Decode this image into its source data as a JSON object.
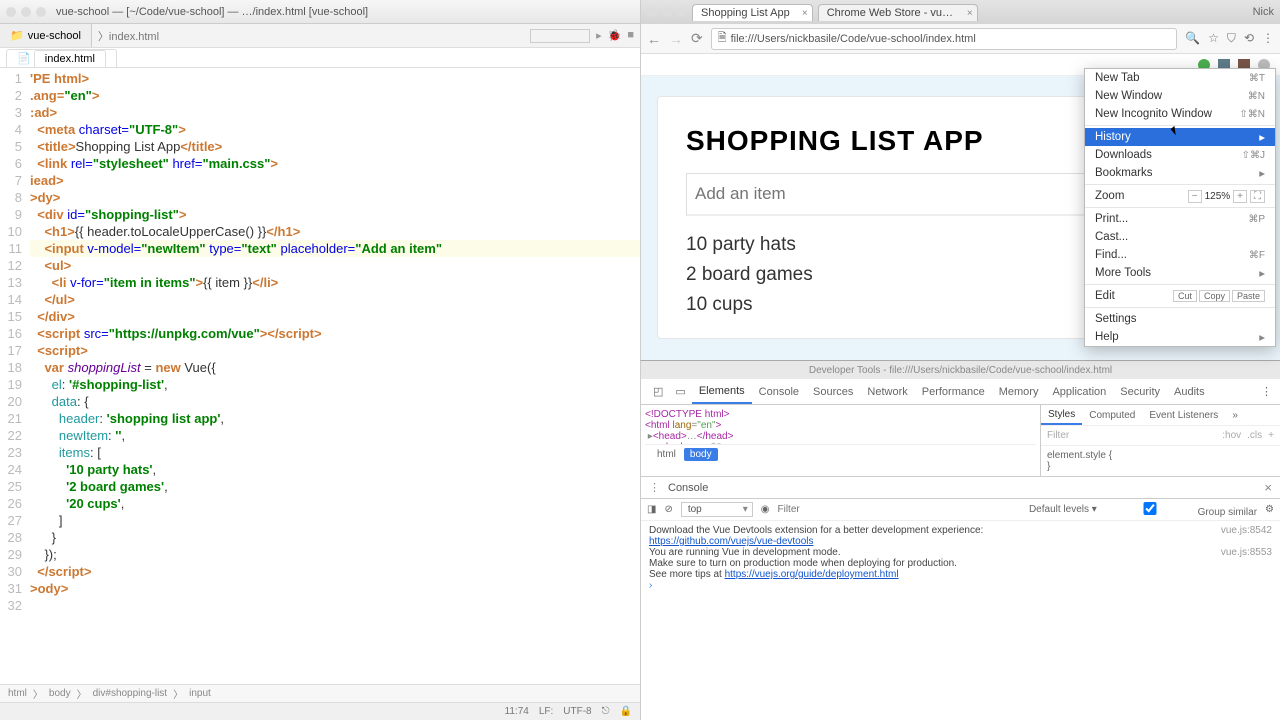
{
  "ide": {
    "project": "vue-school",
    "breadcrumb": "index.html",
    "titlebar": "vue-school — [~/Code/vue-school] — …/index.html [vue-school]",
    "file_tab": "index.html",
    "status": {
      "pos": "11:74",
      "lf": "LF:",
      "enc": "UTF-8"
    },
    "bottom_crumbs": [
      "html",
      "body",
      "div#shopping-list",
      "input"
    ],
    "gutter": [
      "1",
      "2",
      "3",
      "4",
      "5",
      "6",
      "7",
      "8",
      "9",
      "10",
      "11",
      "12",
      "13",
      "14",
      "15",
      "16",
      "17",
      "18",
      "19",
      "20",
      "21",
      "22",
      "23",
      "24",
      "25",
      "26",
      "27",
      "28",
      "29",
      "30",
      "31",
      "32"
    ]
  },
  "chrome": {
    "tabs": [
      {
        "title": "Shopping List App",
        "active": true
      },
      {
        "title": "Chrome Web Store - vue dev",
        "active": false
      }
    ],
    "user": "Nick",
    "url": "file:///Users/nickbasile/Code/vue-school/index.html",
    "page": {
      "header": "SHOPPING LIST APP",
      "placeholder": "Add an item",
      "items": [
        "10 party hats",
        "2 board games",
        "10 cups"
      ]
    },
    "menu": {
      "new_tab": {
        "label": "New Tab",
        "short": "⌘T"
      },
      "new_window": {
        "label": "New Window",
        "short": "⌘N"
      },
      "incognito": {
        "label": "New Incognito Window",
        "short": "⇧⌘N"
      },
      "history": {
        "label": "History",
        "arrow": "▸"
      },
      "downloads": {
        "label": "Downloads",
        "short": "⇧⌘J"
      },
      "bookmarks": {
        "label": "Bookmarks",
        "arrow": "▸"
      },
      "zoom": {
        "label": "Zoom",
        "pct": "125%"
      },
      "print": {
        "label": "Print...",
        "short": "⌘P"
      },
      "cast": {
        "label": "Cast..."
      },
      "find": {
        "label": "Find...",
        "short": "⌘F"
      },
      "more_tools": {
        "label": "More Tools",
        "arrow": "▸"
      },
      "edit": {
        "label": "Edit",
        "cut": "Cut",
        "copy": "Copy",
        "paste": "Paste"
      },
      "settings": {
        "label": "Settings"
      },
      "help": {
        "label": "Help",
        "arrow": "▸"
      }
    }
  },
  "devtools": {
    "title": "Developer Tools - file:///Users/nickbasile/Code/vue-school/index.html",
    "tabs": [
      "Elements",
      "Console",
      "Sources",
      "Network",
      "Performance",
      "Memory",
      "Application",
      "Security",
      "Audits"
    ],
    "style_tabs": [
      "Styles",
      "Computed",
      "Event Listeners"
    ],
    "filter_placeholder": "Filter",
    "hov": ":hov",
    "cls": ".cls",
    "element_style": "element.style {",
    "style_close": "}",
    "dom_crumbs": [
      "html",
      "body"
    ],
    "console_label": "Console",
    "top": "top",
    "default_levels": "Default levels ▾",
    "group_similar": "Group similar",
    "msg1": "Download the Vue Devtools extension for a better development experience:",
    "link1": "https://github.com/vuejs/vue-devtools",
    "src1": "vue.js:8542",
    "msg2a": "You are running Vue in development mode.",
    "msg2b": "Make sure to turn on production mode when deploying for production.",
    "msg2c": "See more tips at ",
    "link2": "https://vuejs.org/guide/deployment.html",
    "src2": "vue.js:8553"
  }
}
